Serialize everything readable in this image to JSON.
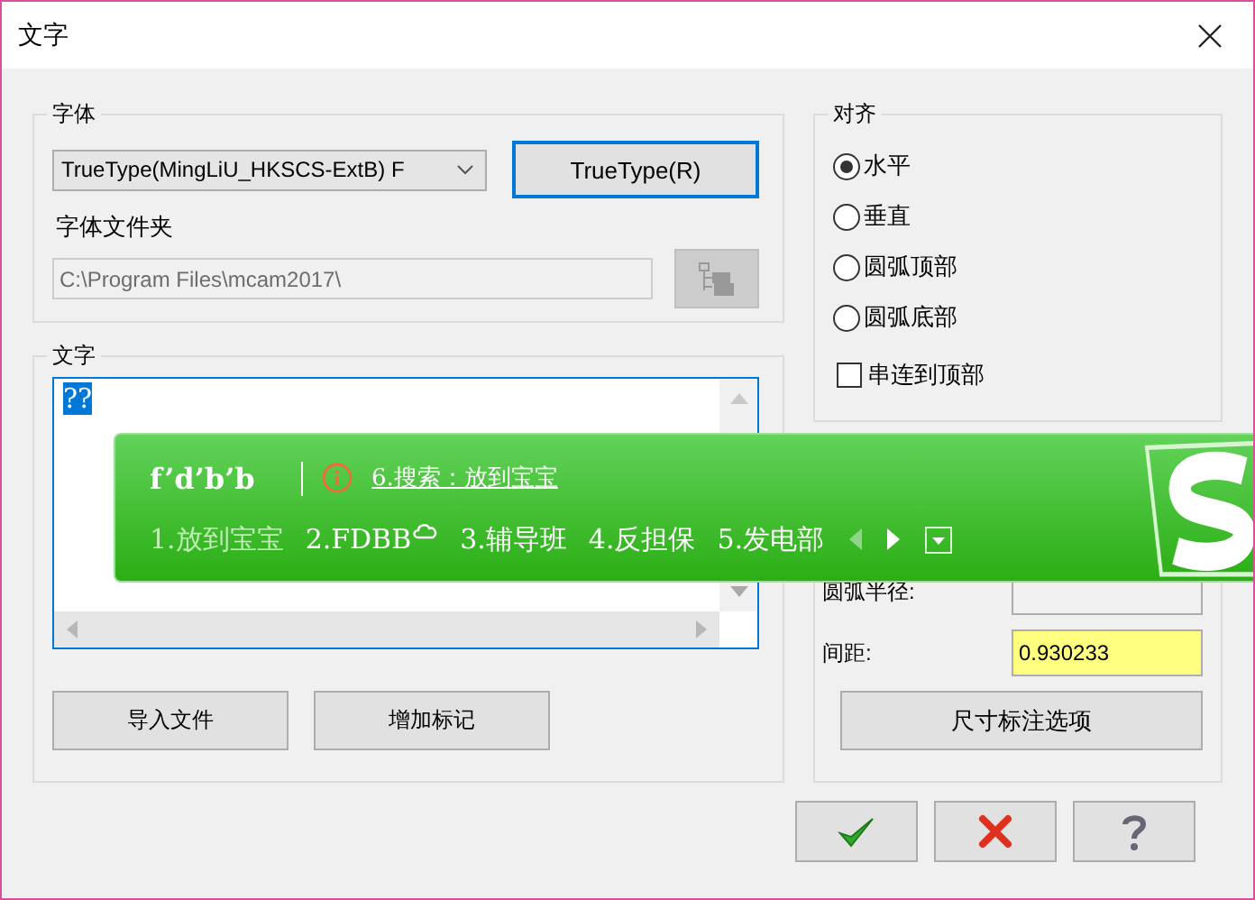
{
  "window": {
    "title": "文字"
  },
  "font_group": {
    "label": "字体",
    "font_select": "TrueType(MingLiU_HKSCS-ExtB) F",
    "truetype_button": "TrueType(R)",
    "folder_label": "字体文件夹",
    "folder_path": "C:\\Program Files\\mcam2017\\"
  },
  "text_group": {
    "label": "文字",
    "text": "??",
    "text_selected": true,
    "buttons": [
      "导入文件",
      "增加标记"
    ]
  },
  "align_group": {
    "label": "对齐",
    "options": [
      {
        "label": "水平",
        "selected": true
      },
      {
        "label": "垂直",
        "selected": false
      },
      {
        "label": "圆弧顶部",
        "selected": false
      },
      {
        "label": "圆弧底部",
        "selected": false
      }
    ],
    "chain_to_top": {
      "label": "串连到顶部",
      "checked": false
    }
  },
  "dimension_group": {
    "fields": [
      {
        "label": "圆弧半径:",
        "highlighted": false
      },
      {
        "label": "间距:",
        "value": "0.930233",
        "highlighted": true
      }
    ],
    "button": "尺寸标注选项"
  },
  "ime": {
    "pinyin": "f’d’b’b",
    "search": "6.搜索：放到宝宝",
    "candidates": [
      {
        "text": "1.放到宝宝",
        "selected": true,
        "cloud": false
      },
      {
        "text": "2.FDBB",
        "selected": false,
        "cloud": true
      },
      {
        "text": "3.辅导班",
        "selected": false,
        "cloud": false
      },
      {
        "text": "4.反担保",
        "selected": false,
        "cloud": false
      },
      {
        "text": "5.发电部",
        "selected": false,
        "cloud": false
      }
    ]
  }
}
